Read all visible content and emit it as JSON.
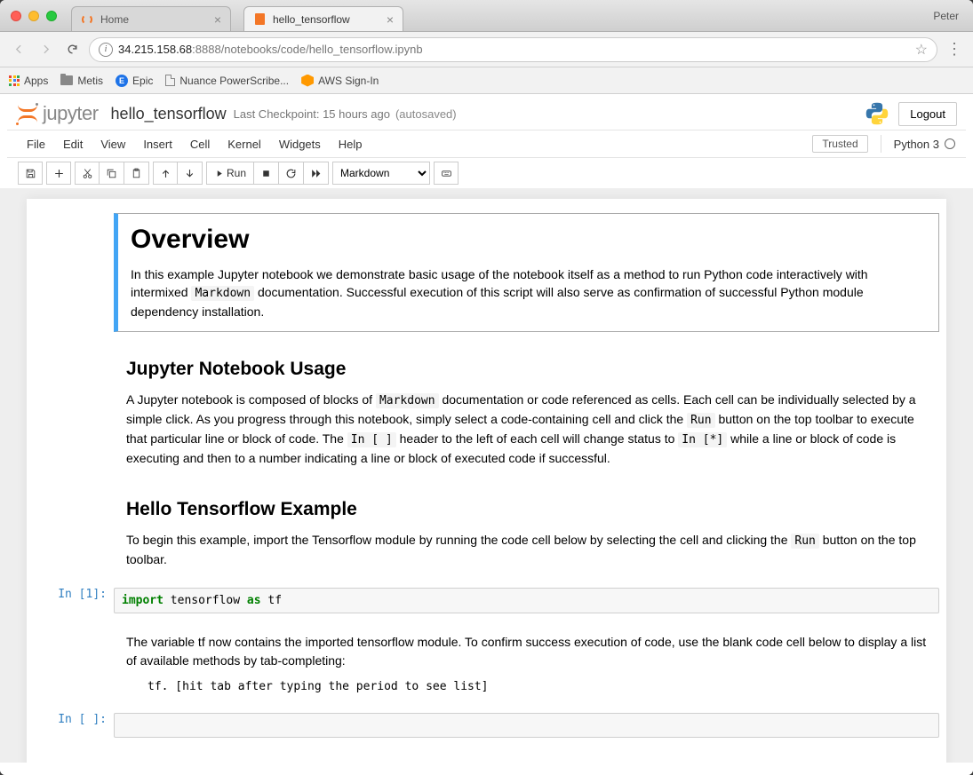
{
  "chrome": {
    "user": "Peter",
    "tabs": [
      {
        "title": "Home",
        "active": false,
        "favicon": "jupyter"
      },
      {
        "title": "hello_tensorflow",
        "active": true,
        "favicon": "notebook"
      }
    ],
    "url_host": "34.215.158.68",
    "url_port": ":8888",
    "url_path": "/notebooks/code/hello_tensorflow.ipynb",
    "bookmarks": {
      "apps": "Apps",
      "metis": "Metis",
      "epic": "Epic",
      "nuance": "Nuance PowerScribe...",
      "aws": "AWS Sign-In"
    }
  },
  "jupyter": {
    "logo_text": "jupyter",
    "notebook_name": "hello_tensorflow",
    "checkpoint": "Last Checkpoint: 15 hours ago",
    "autosaved": "(autosaved)",
    "logout": "Logout",
    "menu": [
      "File",
      "Edit",
      "View",
      "Insert",
      "Cell",
      "Kernel",
      "Widgets",
      "Help"
    ],
    "trusted": "Trusted",
    "kernel": "Python 3",
    "toolbar": {
      "run": "Run",
      "celltype": "Markdown"
    }
  },
  "notebook": {
    "cells": [
      {
        "type": "markdown",
        "selected": true,
        "h1": "Overview",
        "p1_a": "In this example Jupyter notebook we demonstrate basic usage of the notebook itself as a method to run Python code interactively with intermixed ",
        "p1_code": "Markdown",
        "p1_b": " documentation. Successful execution of this script will also serve as confirmation of successful Python module dependency installation."
      },
      {
        "type": "markdown",
        "h2": "Jupyter Notebook Usage",
        "p_a": "A Jupyter notebook is composed of blocks of ",
        "p_c1": "Markdown",
        "p_b": " documentation or code referenced as cells. Each cell can be individually selected by a simple click. As you progress through this notebook, simply select a code-containing cell and click the ",
        "p_c2": "Run",
        "p_c": " button on the top toolbar to execute that particular line or block of code. The ",
        "p_c3": "In [ ]",
        "p_d": " header to the left of each cell will change status to ",
        "p_c4": "In [*]",
        "p_e": " while a line or block of code is executing and then to a number indicating a line or block of executed code if successful."
      },
      {
        "type": "markdown",
        "h2": "Hello Tensorflow Example",
        "p_a": "To begin this example, import the Tensorflow module by running the code cell below by selecting the cell and clicking the ",
        "p_c1": "Run",
        "p_b": " button on the top toolbar."
      },
      {
        "type": "code",
        "prompt": "In [1]:",
        "src_kw1": "import",
        "src_mid": " tensorflow ",
        "src_kw2": "as",
        "src_end": " tf"
      },
      {
        "type": "markdown",
        "p_a": "The variable tf now contains the imported tensorflow module. To confirm success execution of code, use the blank code cell below to display a list of available methods by tab-completing:",
        "pre": "tf. [hit tab after typing the period to see list]"
      },
      {
        "type": "code",
        "prompt": "In [ ]:",
        "src": ""
      }
    ]
  }
}
